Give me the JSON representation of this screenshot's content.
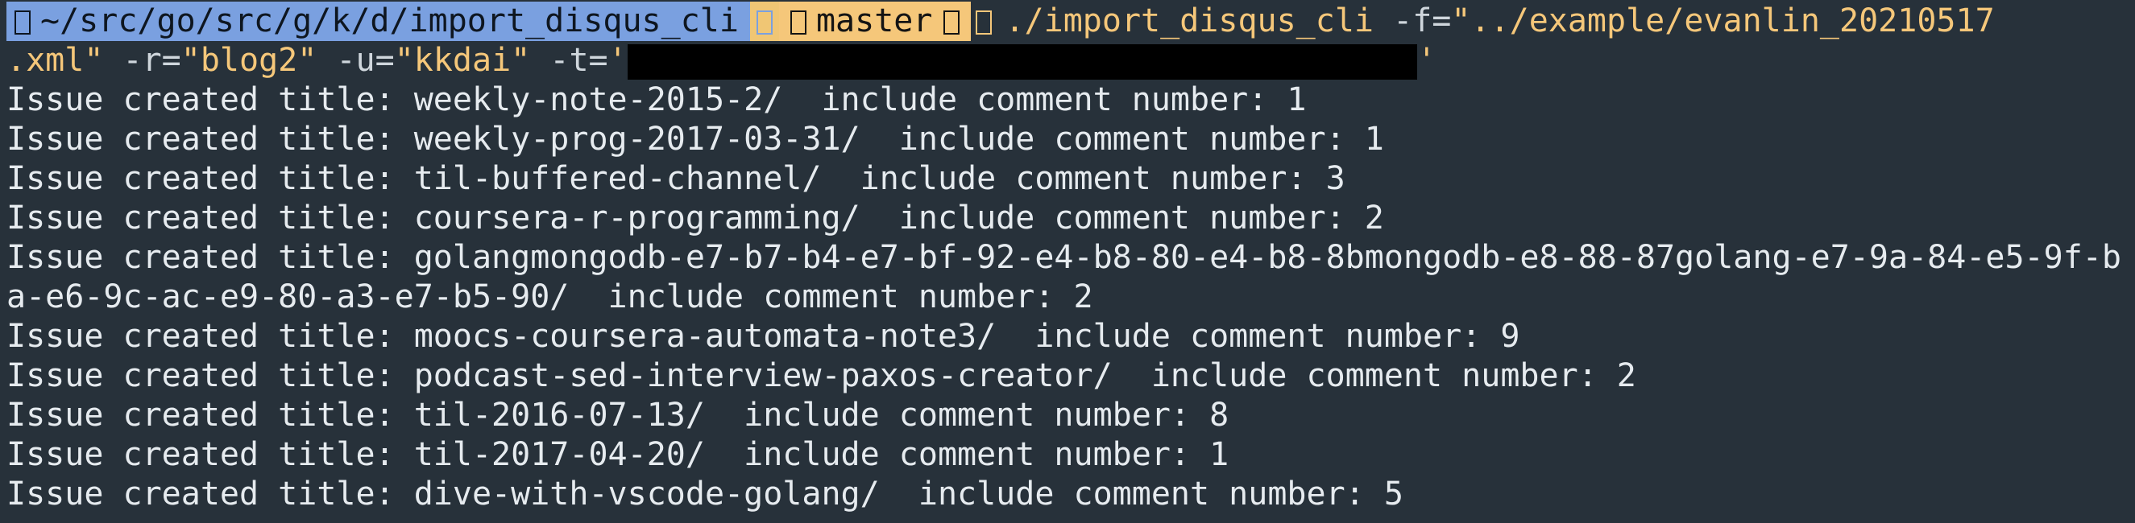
{
  "colors": {
    "background": "#27313a",
    "text": "#e6ebef",
    "prompt_dir_bg": "#7aa0e0",
    "prompt_git_bg": "#f5c77a",
    "command": "#f5c77a",
    "redaction": "#000000"
  },
  "prompt": {
    "dir_icon": "folder-icon",
    "path": "~/src/go/src/g/k/d/import_disqus_cli",
    "branch_icon": "git-branch-icon",
    "branch": "master",
    "status_icon": "arrow-icon"
  },
  "command": {
    "executable": "./import_disqus_cli",
    "flag_f": "-f=",
    "value_f_part1": "\"../example/evanlin_20210517",
    "value_f_part2": ".xml\"",
    "flag_r": "-r=",
    "value_r": "\"blog2\"",
    "flag_u": "-u=",
    "value_u": "\"kkdai\"",
    "flag_t": "-t=",
    "value_t_open": "'",
    "value_t_close": "'"
  },
  "output_lines": [
    "Issue created title: weekly-note-2015-2/  include comment number: 1",
    "Issue created title: weekly-prog-2017-03-31/  include comment number: 1",
    "Issue created title: til-buffered-channel/  include comment number: 3",
    "Issue created title: coursera-r-programming/  include comment number: 2",
    "Issue created title: golangmongodb-e7-b7-b4-e7-bf-92-e4-b8-80-e4-b8-8bmongodb-e8-88-87golang-e7-9a-84-e5-9f-b",
    "a-e6-9c-ac-e9-80-a3-e7-b5-90/  include comment number: 2",
    "Issue created title: moocs-coursera-automata-note3/  include comment number: 9",
    "Issue created title: podcast-sed-interview-paxos-creator/  include comment number: 2",
    "Issue created title: til-2016-07-13/  include comment number: 8",
    "Issue created title: til-2017-04-20/  include comment number: 1",
    "Issue created title: dive-with-vscode-golang/  include comment number: 5"
  ]
}
